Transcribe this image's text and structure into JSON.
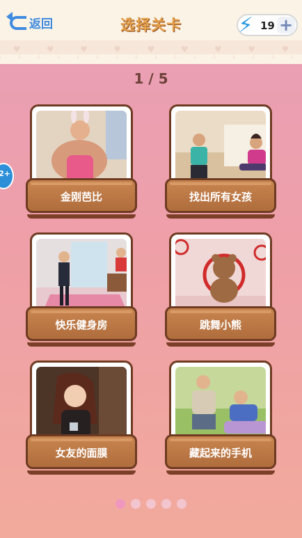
{
  "header": {
    "back_label": "返回",
    "title": "选择关卡",
    "energy_count": "19",
    "plus_label": "+"
  },
  "pager": {
    "indicator": "1 / 5",
    "pages": 5,
    "current": 1
  },
  "side_badge": "2+",
  "levels": [
    {
      "label": "金刚芭比"
    },
    {
      "label": "找出所有女孩"
    },
    {
      "label": "快乐健身房"
    },
    {
      "label": "跳舞小熊"
    },
    {
      "label": "女友的面膜"
    },
    {
      "label": "藏起来的手机"
    }
  ],
  "colors": {
    "accent": "#3f8be0",
    "title": "#e5a04a",
    "card_label": "#b06d3d",
    "active_dot": "#f097c0"
  }
}
